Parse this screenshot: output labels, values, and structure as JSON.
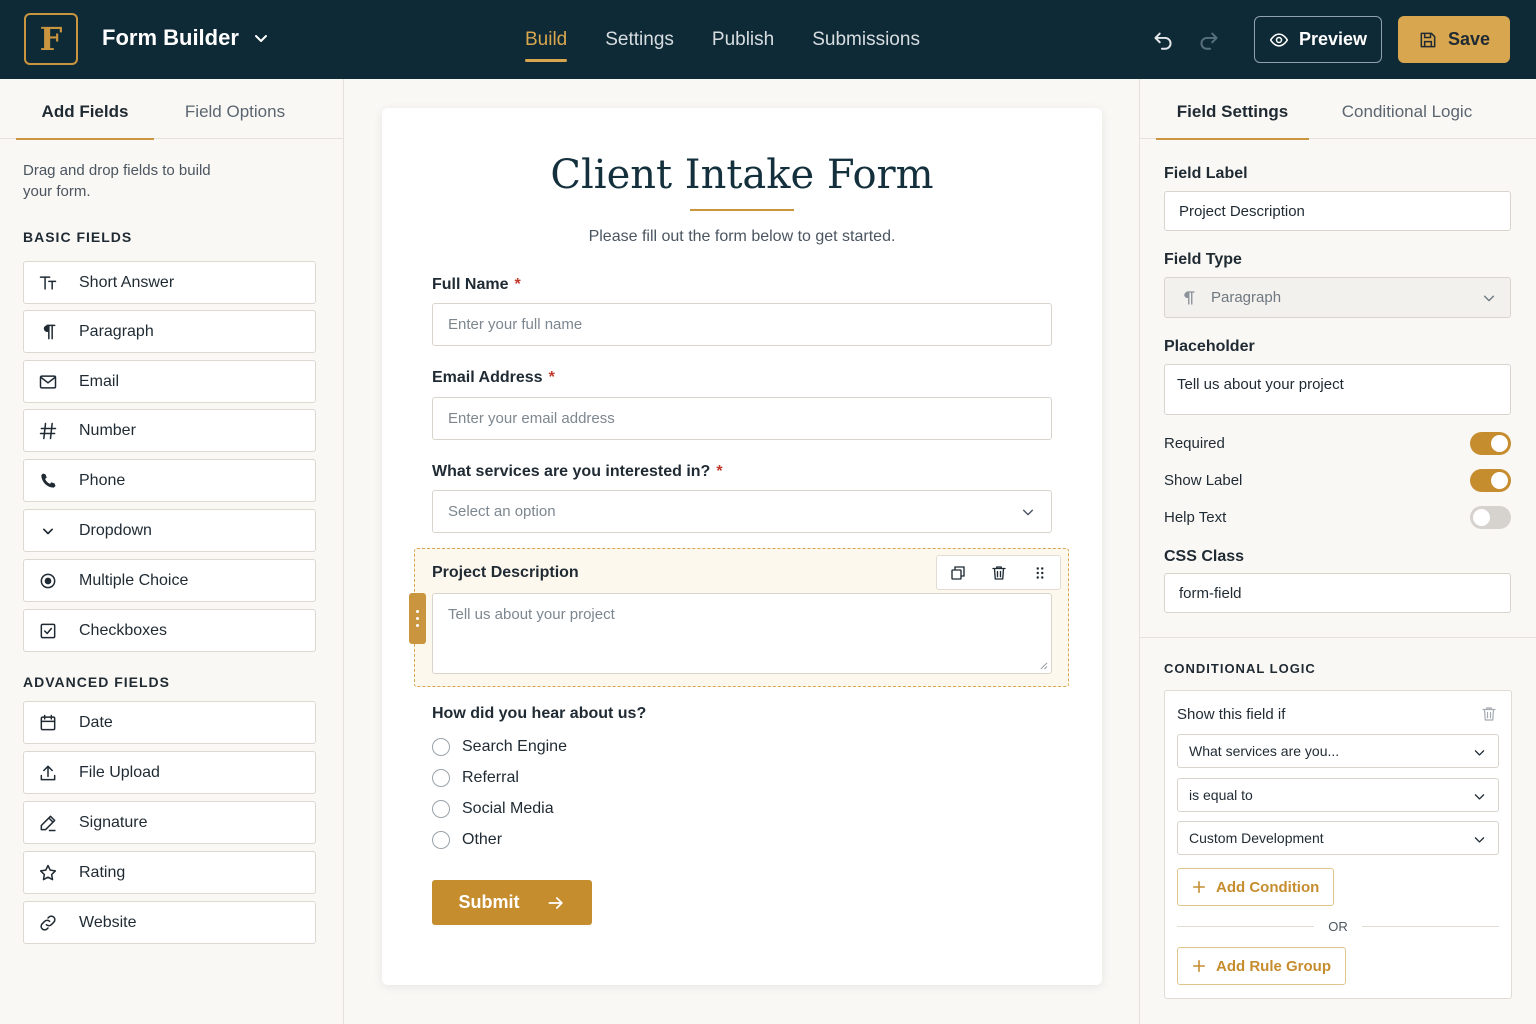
{
  "header": {
    "logo_letter": "F",
    "app_title": "Form Builder",
    "nav": [
      "Build",
      "Settings",
      "Publish",
      "Submissions"
    ],
    "active_nav": "Build",
    "preview_label": "Preview",
    "save_label": "Save"
  },
  "left_panel": {
    "tabs": [
      "Add Fields",
      "Field Options"
    ],
    "active_tab": "Add Fields",
    "helper_text": "Drag and drop fields to build your form.",
    "basic_heading": "BASIC FIELDS",
    "basic_fields": [
      {
        "label": "Short Answer",
        "icon": "text-size-icon"
      },
      {
        "label": "Paragraph",
        "icon": "paragraph-icon"
      },
      {
        "label": "Email",
        "icon": "envelope-icon"
      },
      {
        "label": "Number",
        "icon": "hash-icon"
      },
      {
        "label": "Phone",
        "icon": "phone-icon"
      },
      {
        "label": "Dropdown",
        "icon": "chevron-down-icon"
      },
      {
        "label": "Multiple Choice",
        "icon": "radio-icon"
      },
      {
        "label": "Checkboxes",
        "icon": "checkbox-icon"
      }
    ],
    "advanced_heading": "ADVANCED FIELDS",
    "advanced_fields": [
      {
        "label": "Date",
        "icon": "calendar-icon"
      },
      {
        "label": "File Upload",
        "icon": "upload-icon"
      },
      {
        "label": "Signature",
        "icon": "pen-icon"
      },
      {
        "label": "Rating",
        "icon": "star-icon"
      },
      {
        "label": "Website",
        "icon": "link-icon"
      }
    ]
  },
  "form": {
    "title": "Client Intake Form",
    "subtitle": "Please fill out the form below to get started.",
    "full_name": {
      "label": "Full Name",
      "required_mark": "*",
      "placeholder": "Enter your full name"
    },
    "email": {
      "label": "Email Address",
      "required_mark": "*",
      "placeholder": "Enter your email address"
    },
    "services": {
      "label": "What services are you interested in?",
      "required_mark": "*",
      "placeholder": "Select an option"
    },
    "project": {
      "label": "Project Description",
      "placeholder": "Tell us about your project"
    },
    "heard": {
      "label": "How did you hear about us?",
      "options": [
        "Search Engine",
        "Referral",
        "Social Media",
        "Other"
      ]
    },
    "submit_label": "Submit"
  },
  "right_panel": {
    "tabs": [
      "Field Settings",
      "Conditional Logic"
    ],
    "active_tab": "Field Settings",
    "field_label_title": "Field Label",
    "field_label_value": "Project Description",
    "field_type_title": "Field Type",
    "field_type_value": "Paragraph",
    "placeholder_title": "Placeholder",
    "placeholder_value": "Tell us about your project",
    "toggles": [
      {
        "label": "Required",
        "on": true
      },
      {
        "label": "Show Label",
        "on": true
      },
      {
        "label": "Help Text",
        "on": false
      }
    ],
    "css_class_title": "CSS Class",
    "css_class_value": "form-field",
    "logic_heading": "CONDITIONAL LOGIC",
    "logic_title": "Show this field if",
    "logic_field": "What services are you...",
    "logic_operator": "is equal to",
    "logic_value": "Custom Development",
    "add_condition": "Add Condition",
    "or_label": "OR",
    "add_rule_group": "Add Rule Group"
  },
  "colors": {
    "navy": "#0e2a36",
    "gold": "#c9963f",
    "accent": "#d8a64e"
  }
}
